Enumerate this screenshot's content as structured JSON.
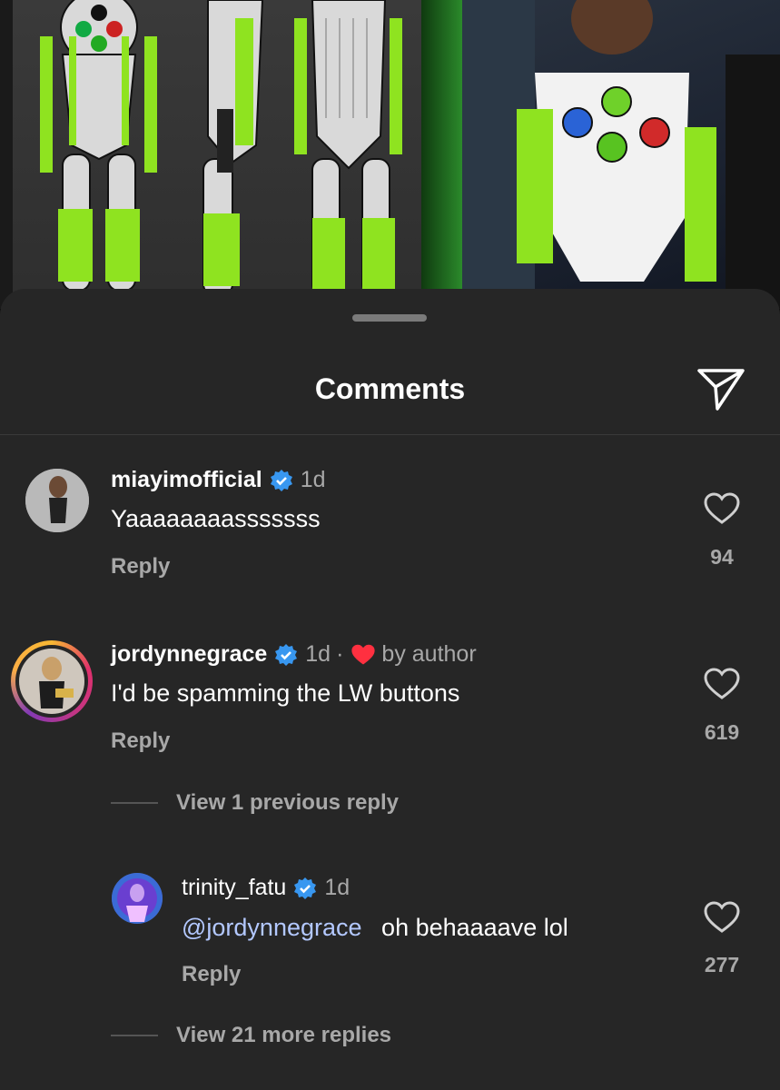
{
  "sheet": {
    "title": "Comments",
    "share_icon": "paper-plane-icon"
  },
  "comments": [
    {
      "username": "miayimofficial",
      "verified": true,
      "time": "1d",
      "text": "Yaaaaaaaasssssss",
      "reply_label": "Reply",
      "likes": "94"
    },
    {
      "username": "jordynnegrace",
      "verified": true,
      "time": "1d",
      "separator": "·",
      "liked_by_author": "by author",
      "text": "I'd be spamming the LW buttons",
      "reply_label": "Reply",
      "likes": "619",
      "view_previous": "View 1 previous reply",
      "replies": [
        {
          "username": "trinity_fatu",
          "verified": true,
          "time": "1d",
          "mention": "@jordynnegrace",
          "text": "oh behaaaave lol",
          "reply_label": "Reply",
          "likes": "277"
        }
      ],
      "view_more": "View 21 more replies"
    }
  ],
  "colors": {
    "sheet_bg": "#262626",
    "verified_blue": "#3897f0",
    "author_heart": "#ff3040",
    "mention": "#b3c8ff",
    "muted": "#a8a8a8"
  }
}
